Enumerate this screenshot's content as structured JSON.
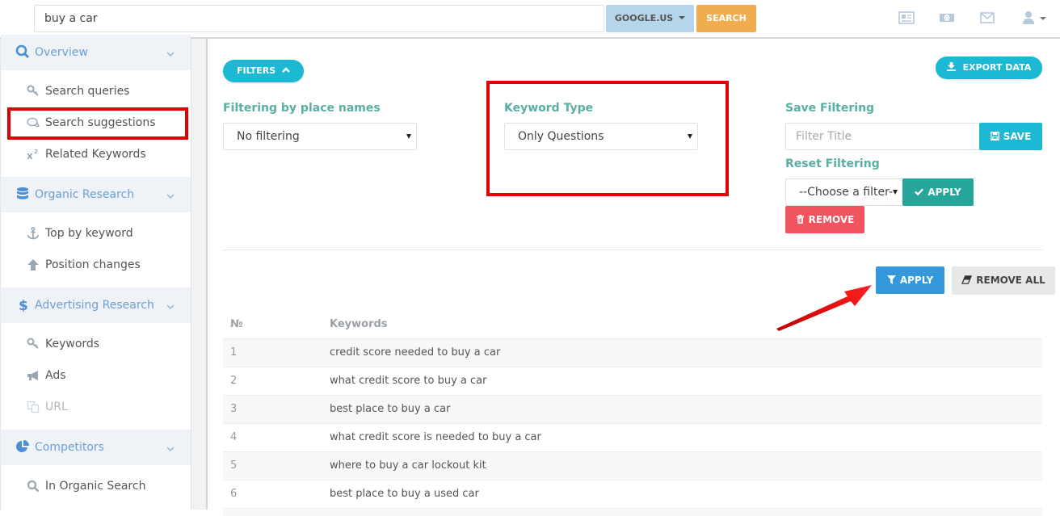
{
  "topbar": {
    "search_value": "buy a car",
    "engine_label": "GOOGLE.US",
    "search_label": "SEARCH",
    "icons": [
      "newspaper-icon",
      "money-icon",
      "envelope-icon",
      "user-icon"
    ]
  },
  "sidebar": {
    "groups": [
      {
        "label": "Overview",
        "icon": "search-icon",
        "items": [
          {
            "label": "Search queries",
            "icon": "key-icon"
          },
          {
            "label": "Search suggestions",
            "icon": "comments-icon"
          },
          {
            "label": "Related Keywords",
            "icon": "superscript-icon"
          }
        ]
      },
      {
        "label": "Organic Research",
        "icon": "database-icon",
        "items": [
          {
            "label": "Top by keyword",
            "icon": "anchor-icon"
          },
          {
            "label": "Position changes",
            "icon": "arrow-up-icon"
          }
        ]
      },
      {
        "label": "Advertising Research",
        "icon": "dollar-icon",
        "items": [
          {
            "label": "Keywords",
            "icon": "key-icon"
          },
          {
            "label": "Ads",
            "icon": "bullhorn-icon"
          },
          {
            "label": "URL",
            "icon": "copy-icon",
            "disabled": true
          }
        ]
      },
      {
        "label": "Competitors",
        "icon": "pie-chart-icon",
        "items": [
          {
            "label": "In Organic Search",
            "icon": "search-icon"
          }
        ]
      }
    ]
  },
  "main": {
    "filters_label": "FILTERS",
    "export_label": "EXPORT DATA",
    "place_filter": {
      "label": "Filtering by place names",
      "value": "No filtering"
    },
    "keyword_type": {
      "label": "Keyword Type",
      "value": "Only Questions"
    },
    "save_filtering": {
      "label": "Save Filtering",
      "placeholder": "Filter Title",
      "button": "SAVE"
    },
    "reset_filtering": {
      "label": "Reset Filtering",
      "value": "--Choose a filter--",
      "apply": "APPLY",
      "remove": "REMOVE"
    },
    "apply_label": "APPLY",
    "remove_all_label": "REMOVE ALL",
    "table": {
      "headers": [
        "№",
        "Keywords"
      ],
      "rows": [
        [
          "1",
          "credit score needed to buy a car"
        ],
        [
          "2",
          "what credit score to buy a car"
        ],
        [
          "3",
          "best place to buy a car"
        ],
        [
          "4",
          "what credit score is needed to buy a car"
        ],
        [
          "5",
          "where to buy a car lockout kit"
        ],
        [
          "6",
          "best place to buy a used car"
        ]
      ]
    }
  },
  "colors": {
    "accent": "#1cb8d4",
    "label_green": "#5aafa3",
    "apply_teal": "#26a69a",
    "remove_red": "#f0545f",
    "apply_blue": "#3498db",
    "search_orange": "#f0ad4e",
    "annotation_red": "#e00000"
  }
}
